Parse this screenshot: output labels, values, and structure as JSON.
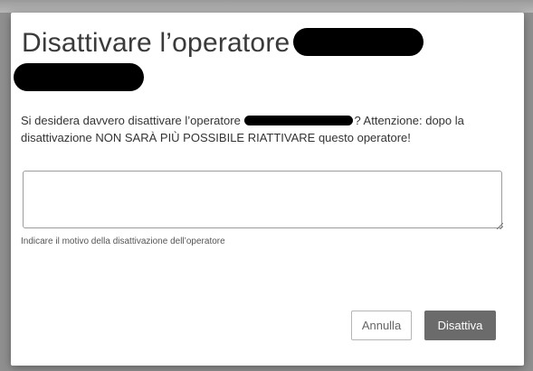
{
  "dialog": {
    "title": "Disattivare l’operatore",
    "message_before": "Si desidera davvero disattivare l’operatore",
    "message_after": "? Attenzione: dopo la disattivazione NON SARÀ PIÙ POSSIBILE RIATTIVARE questo operatore!",
    "reason_value": "",
    "reason_hint": "Indicare il motivo della disattivazione dell’operatore",
    "cancel_label": "Annulla",
    "confirm_label": "Disattiva"
  },
  "colors": {
    "confirm_bg": "#6b6b6b",
    "redaction": "#000000"
  }
}
